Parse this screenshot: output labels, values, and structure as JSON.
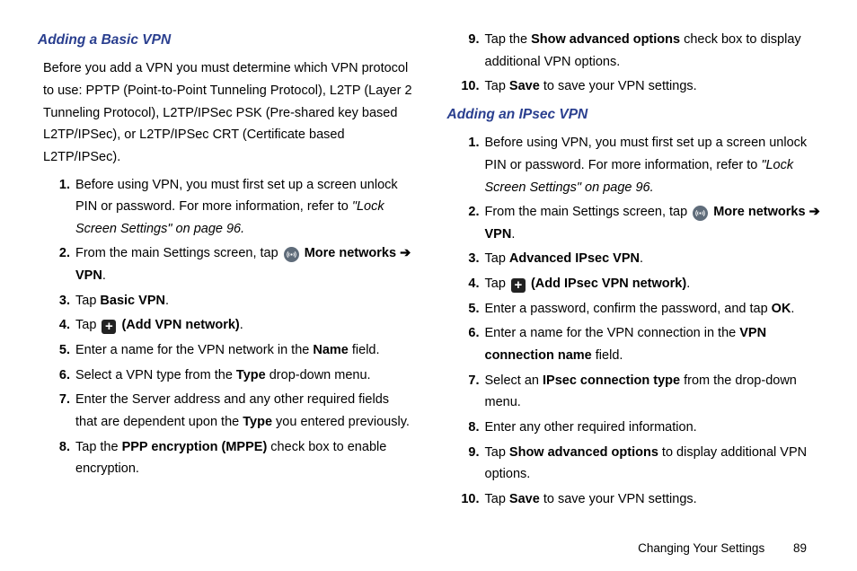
{
  "left": {
    "heading": "Adding a Basic VPN",
    "intro": "Before you add a VPN you must determine which VPN protocol to use: PPTP (Point-to-Point Tunneling Protocol), L2TP (Layer 2 Tunneling Protocol), L2TP/IPSec PSK (Pre-shared key based L2TP/IPSec), or L2TP/IPSec CRT (Certificate based L2TP/IPSec).",
    "s1a": "Before using VPN, you must first set up a screen unlock PIN or password. For more information, refer to ",
    "s1b": "\"Lock Screen Settings\"  on page 96.",
    "s2a": "From the main Settings screen, tap ",
    "s2b": "More networks",
    "s2c": "VPN",
    "s3a": "Tap ",
    "s3b": "Basic VPN",
    "s4a": "Tap ",
    "s4b": "(Add VPN network)",
    "s5a": "Enter a name for the VPN network in the ",
    "s5b": "Name",
    "s5c": " field.",
    "s6a": "Select a VPN type from the ",
    "s6b": "Type",
    "s6c": " drop-down menu.",
    "s7a": "Enter the Server address and any other required fields that are dependent upon the ",
    "s7b": "Type",
    "s7c": " you entered previously.",
    "s8a": "Tap the ",
    "s8b": "PPP encryption (MPPE)",
    "s8c": " check box to enable encryption."
  },
  "right": {
    "s9a": "Tap the ",
    "s9b": "Show advanced options",
    "s9c": " check box to display additional VPN options.",
    "s10a": "Tap ",
    "s10b": "Save",
    "s10c": " to save your VPN settings.",
    "heading": "Adding an IPsec VPN",
    "r1a": "Before using VPN, you must first set up a screen unlock PIN or password. For more information, refer to ",
    "r1b": "\"Lock Screen Settings\"  on page 96.",
    "r2a": "From the main Settings screen, tap ",
    "r2b": "More networks",
    "r2c": "VPN",
    "r3a": "Tap ",
    "r3b": "Advanced IPsec VPN",
    "r4a": "Tap ",
    "r4b": "(Add IPsec VPN network)",
    "r5a": "Enter a password, confirm the password, and tap ",
    "r5b": "OK",
    "r6a": "Enter a name for the VPN connection in the ",
    "r6b": "VPN connection name",
    "r6c": " field.",
    "r7a": "Select an ",
    "r7b": "IPsec connection type",
    "r7c": " from the drop-down menu.",
    "r8": "Enter any other required information.",
    "r9a": "Tap ",
    "r9b": "Show advanced options",
    "r9c": " to display additional VPN options.",
    "r10a": "Tap ",
    "r10b": "Save",
    "r10c": " to save your VPN settings."
  },
  "footer": {
    "section": "Changing Your Settings",
    "page": "89"
  },
  "glyphs": {
    "arrow": "➔",
    "plus": "+"
  }
}
